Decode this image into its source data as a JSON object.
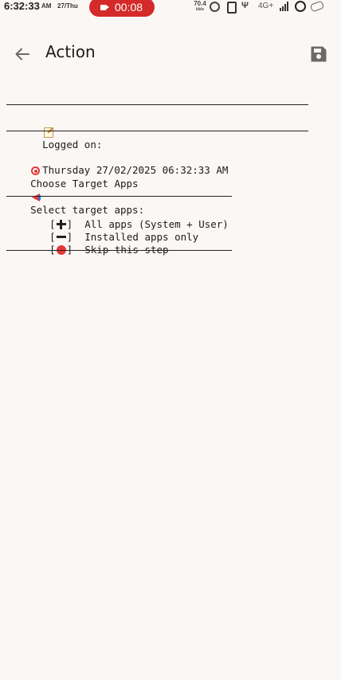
{
  "status_bar": {
    "time": "6:32:33",
    "ampm": "AM",
    "date": "27/Thu",
    "recording_time": "00:08",
    "net_speed_value": "70.4",
    "net_speed_unit": "kb/s",
    "volte_label": "Ψ",
    "network_type": "4G+",
    "icons": [
      "recording-icon",
      "alarm-icon",
      "phone-icon",
      "volte-icon",
      "signal-icon",
      "ring-icon",
      "battery-icon"
    ]
  },
  "app_bar": {
    "title": "Action",
    "back_icon": "arrow-left-icon",
    "save_icon": "save-icon"
  },
  "log": {
    "logged_on_label": "Logged on:",
    "logged_on_value": "Thursday 27/02/2025 06:32:33 AM",
    "choose_target_label": "Choose Target Apps",
    "select_prompt": "Select target apps:",
    "options": [
      {
        "icon": "plus-icon",
        "label": "All apps (System + User)"
      },
      {
        "icon": "minus-icon",
        "label": "Installed apps only"
      },
      {
        "icon": "red-circle-icon",
        "label": "Skip this step"
      }
    ]
  },
  "colors": {
    "background": "#fbf7f4",
    "recording_pill": "#d42a2a",
    "text": "#1d1b1a",
    "icon_gray": "#5f5f5f",
    "accent_red": "#e53935"
  }
}
